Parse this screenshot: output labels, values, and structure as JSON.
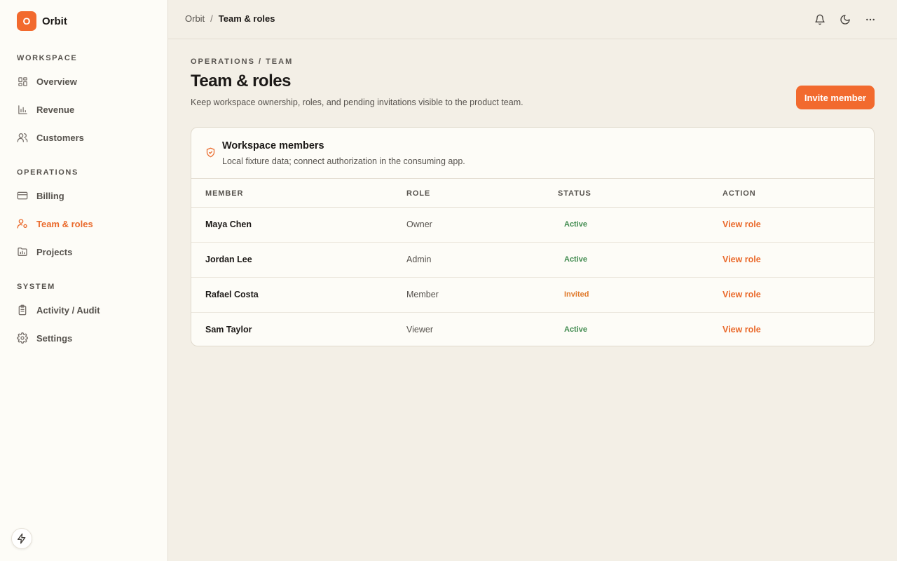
{
  "brand": {
    "logo_letter": "O",
    "name": "Orbit",
    "accent": "#f26a2e"
  },
  "sidebar": {
    "sections": [
      {
        "title": "WORKSPACE",
        "items": [
          {
            "label": "Overview",
            "icon": "layout-grid-icon"
          },
          {
            "label": "Revenue",
            "icon": "bar-chart-icon"
          },
          {
            "label": "Customers",
            "icon": "users-icon"
          }
        ]
      },
      {
        "title": "OPERATIONS",
        "items": [
          {
            "label": "Billing",
            "icon": "credit-card-icon"
          },
          {
            "label": "Team & roles",
            "icon": "user-cog-icon",
            "active": true
          },
          {
            "label": "Projects",
            "icon": "folder-chart-icon"
          }
        ]
      },
      {
        "title": "SYSTEM",
        "items": [
          {
            "label": "Activity / Audit",
            "icon": "clipboard-list-icon"
          },
          {
            "label": "Settings",
            "icon": "gear-icon"
          }
        ]
      }
    ],
    "footer_icon": "bolt-icon"
  },
  "topbar": {
    "breadcrumb": {
      "root": "Orbit",
      "separator": "/",
      "current": "Team & roles"
    },
    "icons": [
      "bell-icon",
      "moon-icon",
      "more-horizontal-icon"
    ]
  },
  "page": {
    "eyebrow": "OPERATIONS / TEAM",
    "title": "Team & roles",
    "description": "Keep workspace ownership, roles, and pending invitations visible to the product team.",
    "primary_button": "Invite member"
  },
  "card": {
    "icon": "shield-check-icon",
    "title": "Workspace members",
    "subtitle": "Local fixture data; connect authorization in the consuming app.",
    "columns": [
      "MEMBER",
      "ROLE",
      "STATUS",
      "ACTION"
    ],
    "rows": [
      {
        "member": "Maya Chen",
        "role": "Owner",
        "status": "Active",
        "action": "View role"
      },
      {
        "member": "Jordan Lee",
        "role": "Admin",
        "status": "Active",
        "action": "View role"
      },
      {
        "member": "Rafael Costa",
        "role": "Member",
        "status": "Invited",
        "action": "View role"
      },
      {
        "member": "Sam Taylor",
        "role": "Viewer",
        "status": "Active",
        "action": "View role"
      }
    ]
  },
  "colors": {
    "status_active": "#3f8a4e",
    "status_invited": "#e07a2c",
    "link": "#ea6a2c"
  }
}
